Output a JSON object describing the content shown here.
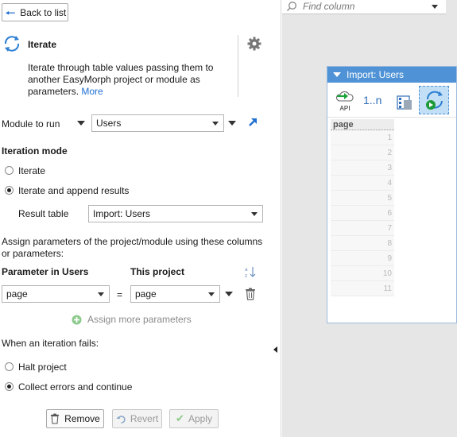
{
  "back_label": "Back to list",
  "step": {
    "title": "Iterate",
    "description": "Iterate through table values passing them to another EasyMorph project or module as parameters.",
    "more_link": "More"
  },
  "module": {
    "label": "Module to run",
    "value": "Users"
  },
  "iteration_mode": {
    "heading": "Iteration mode",
    "options": [
      "Iterate",
      "Iterate and append results"
    ],
    "selected": "Iterate and append results",
    "result_table_label": "Result table",
    "result_table_value": "Import: Users"
  },
  "assign": {
    "description": "Assign parameters of the project/module using these columns or parameters:",
    "col_left": "Parameter in Users",
    "col_right": "This project",
    "left_value": "page",
    "equals": "=",
    "right_value": "page",
    "more_label": "Assign more parameters"
  },
  "failure": {
    "heading": "When an iteration fails:",
    "options": [
      "Halt project",
      "Collect errors and continue"
    ],
    "selected": "Collect errors and continue"
  },
  "buttons": {
    "remove": "Remove",
    "revert": "Revert",
    "apply": "Apply"
  },
  "right": {
    "search_placeholder": "Find column",
    "table_title": "Import: Users",
    "toolbar_seq_label": "1..n",
    "toolbar_api_label": "API",
    "column_header": "page",
    "row_numbers": [
      "1",
      "2",
      "3",
      "4",
      "5",
      "6",
      "7",
      "8",
      "9",
      "10",
      "11"
    ]
  }
}
